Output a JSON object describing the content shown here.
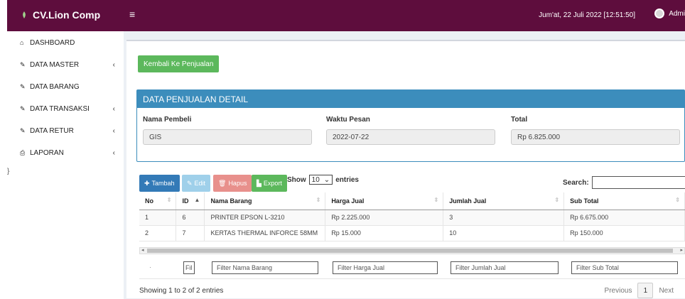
{
  "header": {
    "brand": "CV.Lion Comp",
    "datetime": "Jum'at, 22 Juli 2022 [12:51:50]",
    "user": "Admi"
  },
  "sidebar": {
    "items": [
      {
        "label": "DASHBOARD",
        "icon": "home-icon",
        "has_arrow": false
      },
      {
        "label": "DATA MASTER",
        "icon": "edit-icon",
        "has_arrow": true
      },
      {
        "label": "DATA BARANG",
        "icon": "edit-icon",
        "has_arrow": false
      },
      {
        "label": "DATA TRANSAKSI",
        "icon": "edit-icon",
        "has_arrow": true
      },
      {
        "label": "DATA RETUR",
        "icon": "edit-icon",
        "has_arrow": true
      },
      {
        "label": "LAPORAN",
        "icon": "print-icon",
        "has_arrow": true
      }
    ],
    "arrow": "‹",
    "brace": "}"
  },
  "main": {
    "back_button": "Kembali Ke Penjualan",
    "panel_title": "DATA PENJUALAN DETAIL",
    "fields": [
      {
        "label": "Nama Pembeli",
        "value": "GIS"
      },
      {
        "label": "Waktu Pesan",
        "value": "2022-07-22"
      },
      {
        "label": "Total",
        "value": "Rp 6.825.000"
      }
    ],
    "toolbar": {
      "tambah": "Tambah",
      "edit": "Edit",
      "hapus": "Hapus",
      "export": "Export",
      "show": "Show",
      "entries_value": "10",
      "entries": "entries",
      "search": "Search:"
    },
    "table": {
      "headers": [
        "No",
        "ID",
        "Nama Barang",
        "Harga Jual",
        "Jumlah Jual",
        "Sub Total"
      ],
      "rows": [
        [
          "1",
          "6",
          "PRINTER EPSON L-3210",
          "Rp 2.225.000",
          "3",
          "Rp 6.675.000"
        ],
        [
          "2",
          "7",
          "KERTAS THERMAL INFORCE 58MM",
          "Rp 15.000",
          "10",
          "Rp 150.000"
        ]
      ]
    },
    "filters": {
      "no": "·",
      "id": "Fil",
      "nama": "Filter Nama Barang",
      "harga": "Filter Harga Jual",
      "jumlah": "Filter Jumlah Jual",
      "subtotal": "Filter Sub Total"
    },
    "info": "Showing 1 to 2 of 2 entries",
    "pager": {
      "previous": "Previous",
      "current": "1",
      "next": "Next"
    }
  },
  "colors": {
    "topbar": "#5e0d3d",
    "panel": "#3c8dbc",
    "green": "#5cb85c",
    "blue": "#337ab7",
    "danger": "#d9534f"
  }
}
